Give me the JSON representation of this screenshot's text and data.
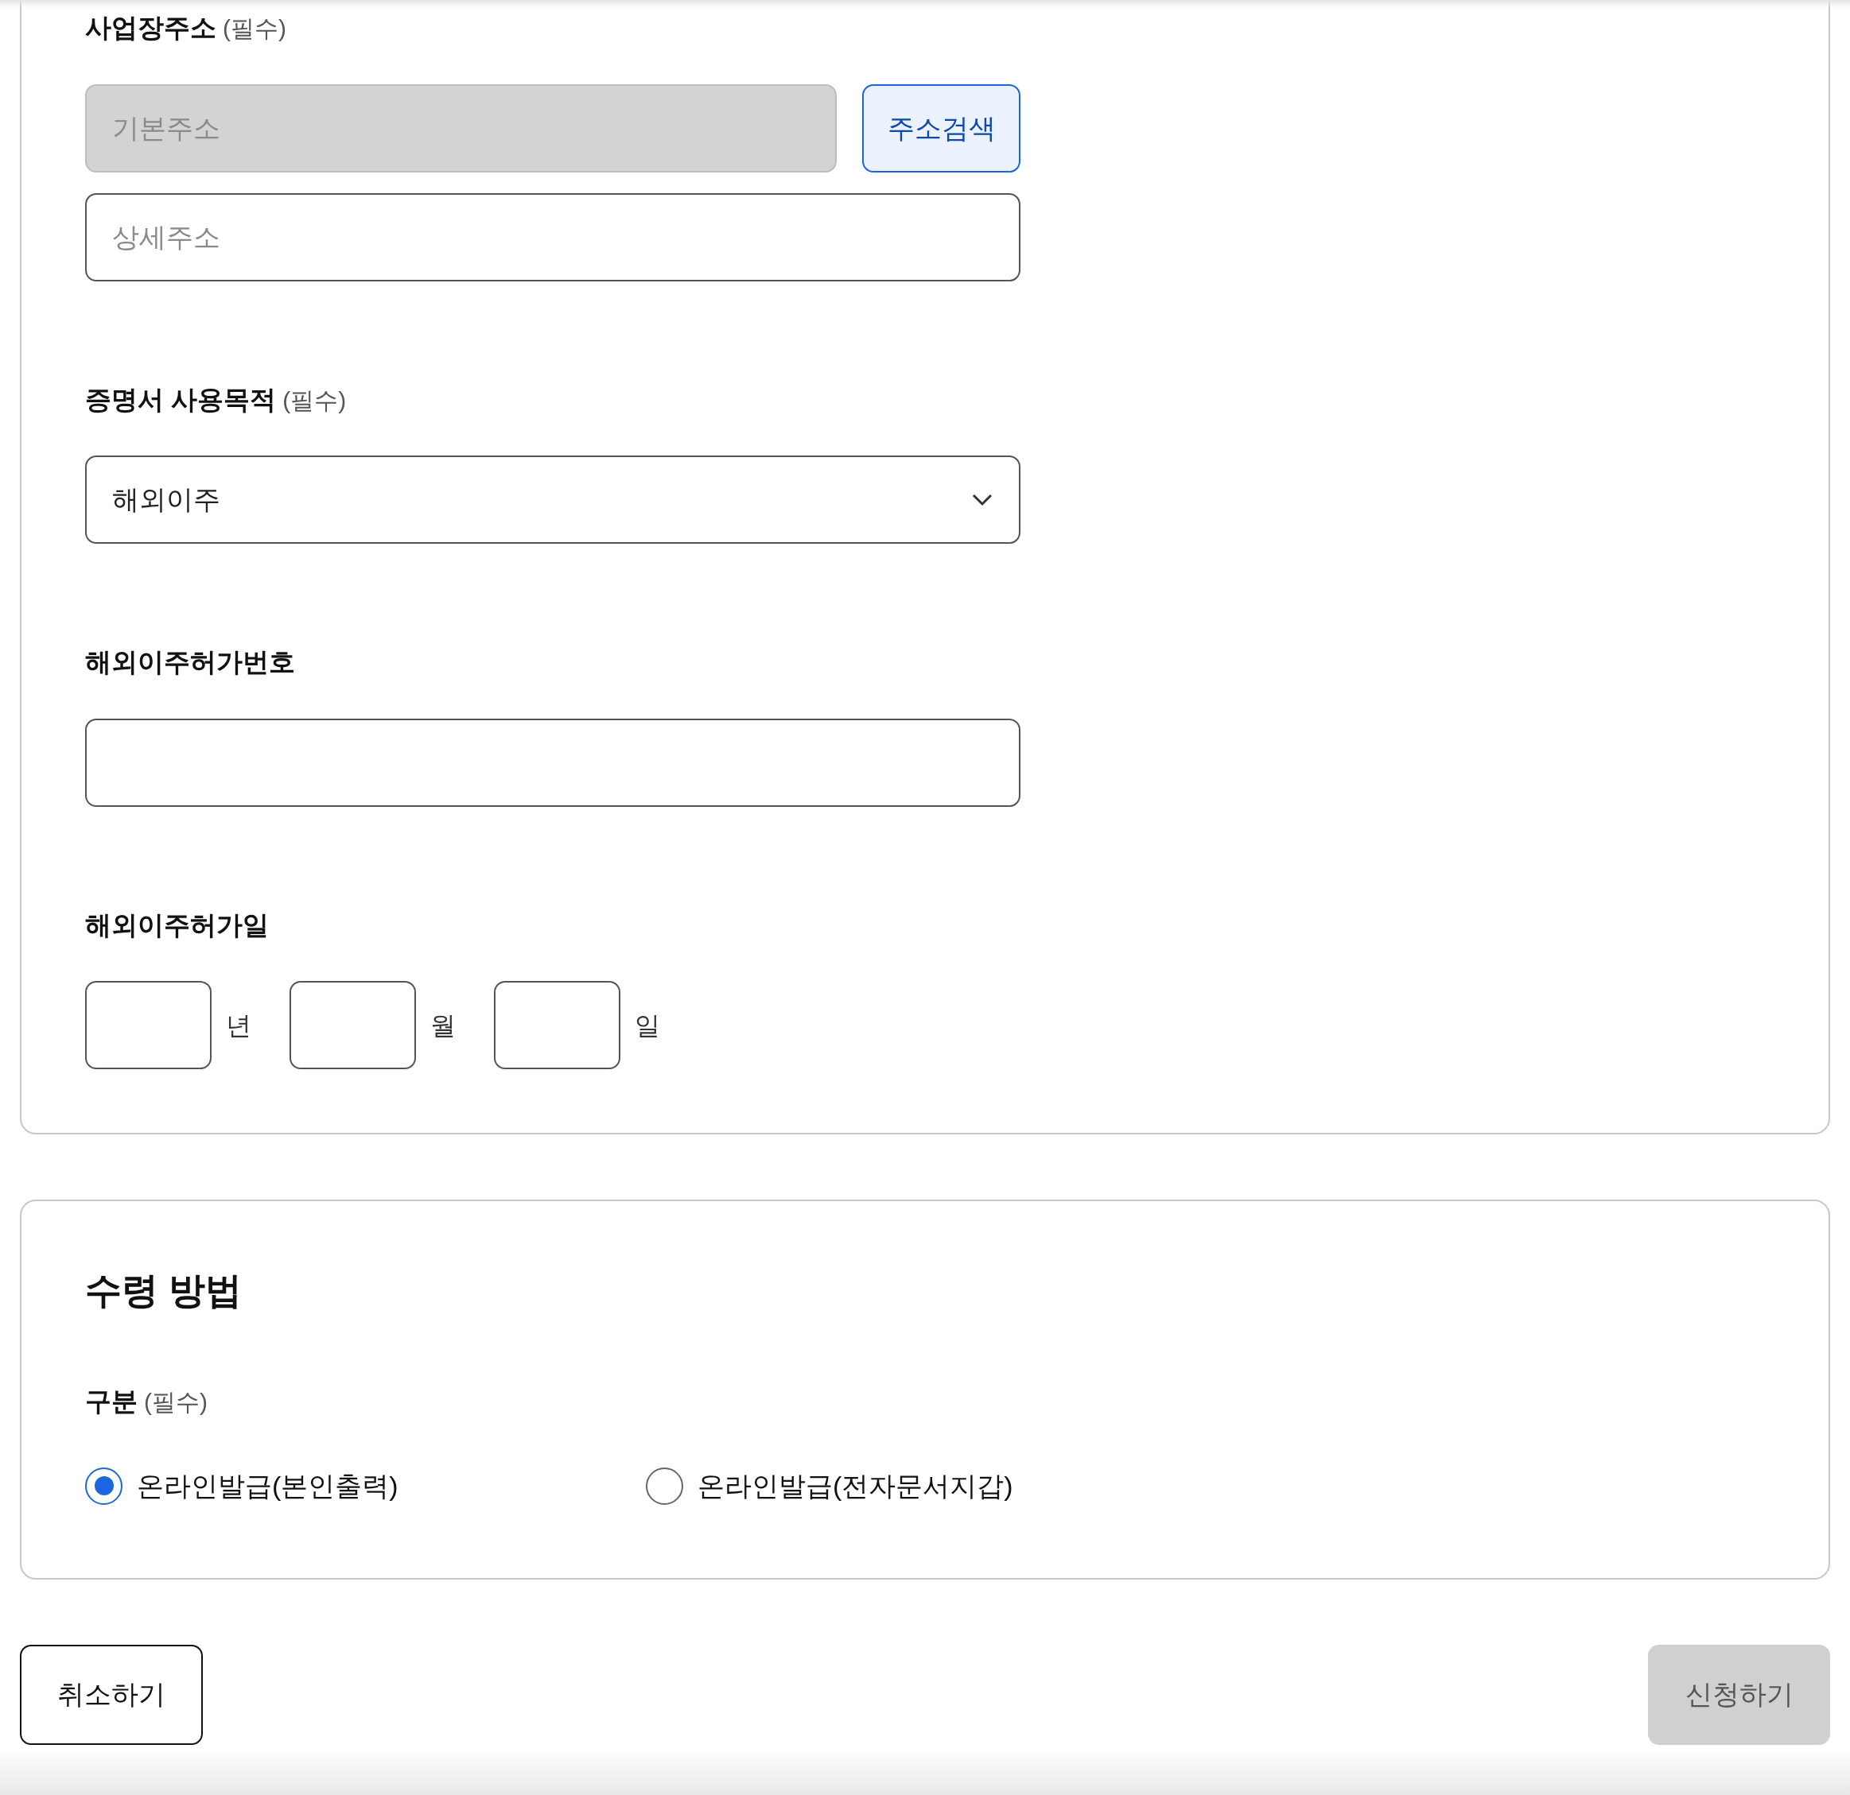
{
  "address": {
    "label": "사업장주소",
    "required": "(필수)",
    "basic": {
      "placeholder": "기본주소",
      "disabled": true
    },
    "detail": {
      "placeholder": "상세주소"
    },
    "search_button": "주소검색"
  },
  "purpose": {
    "label": "증명서 사용목적",
    "required": "(필수)",
    "value": "해외이주"
  },
  "permit_number": {
    "label": "해외이주허가번호"
  },
  "permit_date": {
    "label": "해외이주허가일",
    "parts": [
      "년",
      "월",
      "일"
    ]
  },
  "receipt": {
    "title": "수령 방법",
    "label": "구분",
    "required": "(필수)",
    "options": [
      {
        "label": "온라인발급(본인출력)",
        "selected": true
      },
      {
        "label": "온라인발급(전자문서지갑)",
        "selected": false
      }
    ]
  },
  "buttons": {
    "cancel": "취소하기",
    "submit": {
      "label": "신청하기",
      "disabled": true
    }
  }
}
